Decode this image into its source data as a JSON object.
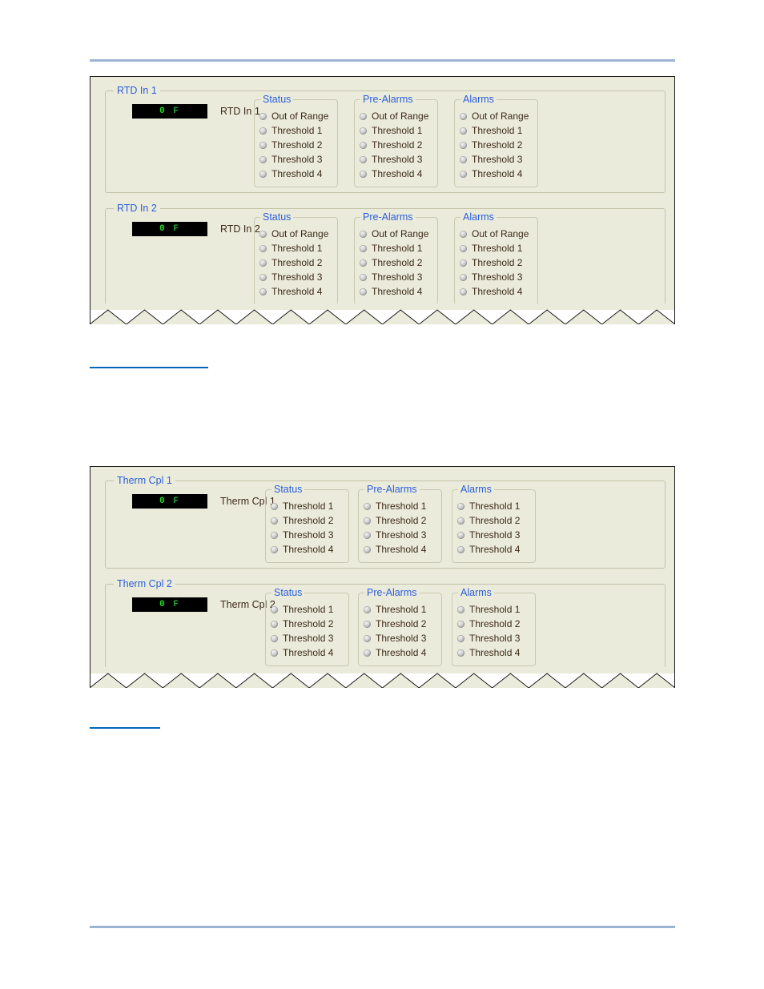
{
  "page": {
    "background_color": "#ffffff",
    "rule_color": "#9cb4d4",
    "panel_background": "#ebebdc",
    "group_label_color": "#2b5fd9",
    "text_color": "#3c2a18",
    "readout_background": "#000000",
    "readout_color": "#22dd22",
    "link_color": "#0066bb"
  },
  "figures": [
    {
      "id": "rtd",
      "groups": [
        {
          "title": "RTD In 1",
          "readout_value": "0",
          "readout_unit": "F",
          "channel_label": "RTD In 1",
          "panels": [
            {
              "title": "Status",
              "leds": [
                {
                  "label": "Out of Range"
                },
                {
                  "label": "Threshold 1"
                },
                {
                  "label": "Threshold 2"
                },
                {
                  "label": "Threshold 3"
                },
                {
                  "label": "Threshold 4"
                }
              ]
            },
            {
              "title": "Pre-Alarms",
              "leds": [
                {
                  "label": "Out of Range"
                },
                {
                  "label": "Threshold 1"
                },
                {
                  "label": "Threshold 2"
                },
                {
                  "label": "Threshold 3"
                },
                {
                  "label": "Threshold 4"
                }
              ]
            },
            {
              "title": "Alarms",
              "leds": [
                {
                  "label": "Out of Range"
                },
                {
                  "label": "Threshold 1"
                },
                {
                  "label": "Threshold 2"
                },
                {
                  "label": "Threshold 3"
                },
                {
                  "label": "Threshold 4"
                }
              ]
            }
          ]
        },
        {
          "title": "RTD In 2",
          "readout_value": "0",
          "readout_unit": "F",
          "channel_label": "RTD In 2",
          "panels": [
            {
              "title": "Status",
              "leds": [
                {
                  "label": "Out of Range"
                },
                {
                  "label": "Threshold 1"
                },
                {
                  "label": "Threshold 2"
                },
                {
                  "label": "Threshold 3"
                },
                {
                  "label": "Threshold 4"
                }
              ]
            },
            {
              "title": "Pre-Alarms",
              "leds": [
                {
                  "label": "Out of Range"
                },
                {
                  "label": "Threshold 1"
                },
                {
                  "label": "Threshold 2"
                },
                {
                  "label": "Threshold 3"
                },
                {
                  "label": "Threshold 4"
                }
              ]
            },
            {
              "title": "Alarms",
              "leds": [
                {
                  "label": "Out of Range"
                },
                {
                  "label": "Threshold 1"
                },
                {
                  "label": "Threshold 2"
                },
                {
                  "label": "Threshold 3"
                },
                {
                  "label": "Threshold 4"
                }
              ]
            }
          ]
        }
      ]
    },
    {
      "id": "thermcpl",
      "groups": [
        {
          "title": "Therm Cpl 1",
          "readout_value": "0",
          "readout_unit": "F",
          "channel_label": "Therm Cpl 1",
          "panels": [
            {
              "title": "Status",
              "leds": [
                {
                  "label": "Threshold 1"
                },
                {
                  "label": "Threshold 2"
                },
                {
                  "label": "Threshold 3"
                },
                {
                  "label": "Threshold 4"
                }
              ]
            },
            {
              "title": "Pre-Alarms",
              "leds": [
                {
                  "label": "Threshold 1"
                },
                {
                  "label": "Threshold 2"
                },
                {
                  "label": "Threshold 3"
                },
                {
                  "label": "Threshold 4"
                }
              ]
            },
            {
              "title": "Alarms",
              "leds": [
                {
                  "label": "Threshold 1"
                },
                {
                  "label": "Threshold 2"
                },
                {
                  "label": "Threshold 3"
                },
                {
                  "label": "Threshold 4"
                }
              ]
            }
          ]
        },
        {
          "title": "Therm Cpl 2",
          "readout_value": "0",
          "readout_unit": "F",
          "channel_label": "Therm Cpl 2",
          "panels": [
            {
              "title": "Status",
              "leds": [
                {
                  "label": "Threshold 1"
                },
                {
                  "label": "Threshold 2"
                },
                {
                  "label": "Threshold 3"
                },
                {
                  "label": "Threshold 4"
                }
              ]
            },
            {
              "title": "Pre-Alarms",
              "leds": [
                {
                  "label": "Threshold 1"
                },
                {
                  "label": "Threshold 2"
                },
                {
                  "label": "Threshold 3"
                },
                {
                  "label": "Threshold 4"
                }
              ]
            },
            {
              "title": "Alarms",
              "leds": [
                {
                  "label": "Threshold 1"
                },
                {
                  "label": "Threshold 2"
                },
                {
                  "label": "Threshold 3"
                },
                {
                  "label": "Threshold 4"
                }
              ]
            }
          ]
        }
      ]
    }
  ],
  "caption_links": [
    {
      "text": ""
    },
    {
      "text": ""
    }
  ]
}
